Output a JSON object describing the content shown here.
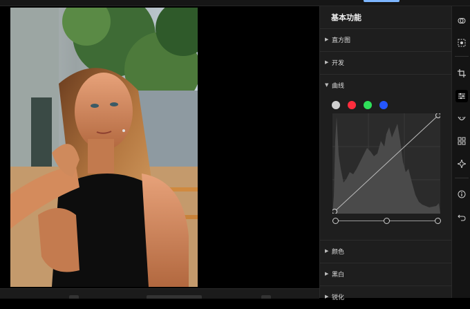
{
  "panel": {
    "title": "基本功能",
    "sections": [
      {
        "label": "直方图",
        "expanded": false
      },
      {
        "label": "开发",
        "expanded": false
      },
      {
        "label": "曲线",
        "expanded": true
      },
      {
        "label": "颜色",
        "expanded": false
      },
      {
        "label": "黑白",
        "expanded": false
      },
      {
        "label": "锐化",
        "expanded": false
      }
    ],
    "curve_channels": [
      {
        "name": "rgb",
        "color": "#d0d0d0"
      },
      {
        "name": "red",
        "color": "#ff2d3d"
      },
      {
        "name": "green",
        "color": "#2fe05a"
      },
      {
        "name": "blue",
        "color": "#2456ff"
      }
    ]
  },
  "rail": {
    "icons": [
      "blend-icon",
      "select-subject-icon",
      "crop-icon",
      "adjust-sliders-icon",
      "mask-icon",
      "grid-icon",
      "ai-sparkle-icon",
      "info-icon",
      "undo-icon"
    ],
    "active": "adjust-sliders-icon"
  },
  "colors": {
    "accent": "#7db6ff",
    "panel_bg": "#1e1e1e"
  }
}
